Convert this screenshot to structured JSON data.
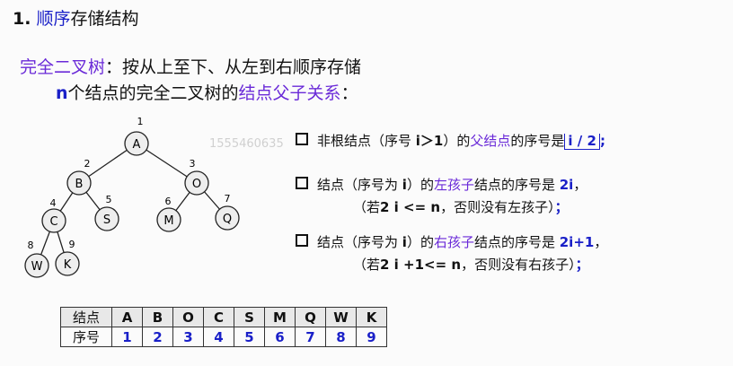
{
  "heading": {
    "number": "1.",
    "accent": "顺序",
    "rest": "存储结构"
  },
  "intro": {
    "term": "完全二叉树",
    "line1_rest": "：按从上至下、从左到右顺序存储",
    "line2_n": "n",
    "line2_a": "个结点的完全二叉树的",
    "line2_b": "结点父子关系",
    "line2_c": "："
  },
  "watermark": "1555460635",
  "tree": {
    "nodes": [
      {
        "label": "A",
        "index": "1"
      },
      {
        "label": "B",
        "index": "2"
      },
      {
        "label": "O",
        "index": "3"
      },
      {
        "label": "C",
        "index": "4"
      },
      {
        "label": "S",
        "index": "5"
      },
      {
        "label": "M",
        "index": "6"
      },
      {
        "label": "Q",
        "index": "7"
      },
      {
        "label": "W",
        "index": "8"
      },
      {
        "label": "K",
        "index": "9"
      }
    ]
  },
  "rules": {
    "r1": {
      "a": "非根结点（序号 ",
      "b": "i＞1",
      "c": "）的",
      "d": "父结点",
      "e": "的序号是",
      "f": "i / 2",
      "g": ";"
    },
    "r2": {
      "a": "结点（序号为 ",
      "b": "i",
      "c": "）的",
      "d": "左孩子",
      "e": "结点的序号是 ",
      "f": "2i",
      "g": "，",
      "p1": "（若",
      "p2": "2 i <= n",
      "p3": "，否则没有左孩子）",
      "p4": "；"
    },
    "r3": {
      "a": "结点（序号为 ",
      "b": "i",
      "c": "）的",
      "d": "右孩子",
      "e": "结点的序号是 ",
      "f": "2i+1",
      "g": "，",
      "p1": "（若",
      "p2": "2 i +1<= n",
      "p3": "，否则没有右孩子）",
      "p4": "；"
    }
  },
  "table": {
    "header_node": "结点",
    "header_index": "序号",
    "labels": [
      "A",
      "B",
      "O",
      "C",
      "S",
      "M",
      "Q",
      "W",
      "K"
    ],
    "indices": [
      "1",
      "2",
      "3",
      "4",
      "5",
      "6",
      "7",
      "8",
      "9"
    ]
  }
}
